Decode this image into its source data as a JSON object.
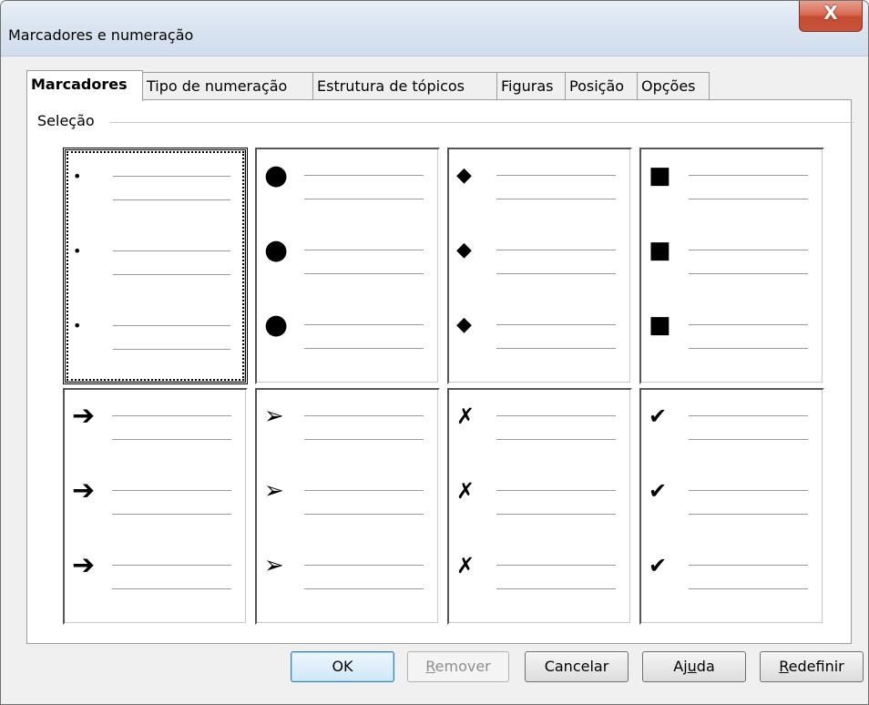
{
  "window": {
    "title": "Marcadores e numeração",
    "close_label": "X"
  },
  "tabs": [
    {
      "label": "Marcadores",
      "active": true
    },
    {
      "label": "Tipo de numeração",
      "active": false
    },
    {
      "label": "Estrutura de tópicos",
      "active": false
    },
    {
      "label": "Figuras",
      "active": false
    },
    {
      "label": "Posição",
      "active": false
    },
    {
      "label": "Opções",
      "active": false
    }
  ],
  "selection": {
    "label": "Seleção",
    "styles": [
      {
        "name": "small-dot",
        "glyph": "•",
        "selected": true
      },
      {
        "name": "large-dot",
        "glyph": "●",
        "selected": false
      },
      {
        "name": "diamond",
        "glyph": "◆",
        "selected": false
      },
      {
        "name": "square",
        "glyph": "■",
        "selected": false
      },
      {
        "name": "arrow",
        "glyph": "➔",
        "selected": false
      },
      {
        "name": "arrowhead",
        "glyph": "➢",
        "selected": false
      },
      {
        "name": "cross",
        "glyph": "✗",
        "selected": false
      },
      {
        "name": "check",
        "glyph": "✔",
        "selected": false
      }
    ]
  },
  "buttons": {
    "ok": "OK",
    "remove": {
      "pre": "",
      "accel": "R",
      "post": "emover"
    },
    "cancel": "Cancelar",
    "help": {
      "pre": "Aj",
      "accel": "u",
      "post": "da"
    },
    "reset": {
      "pre": "",
      "accel": "R",
      "post": "edefinir"
    }
  }
}
